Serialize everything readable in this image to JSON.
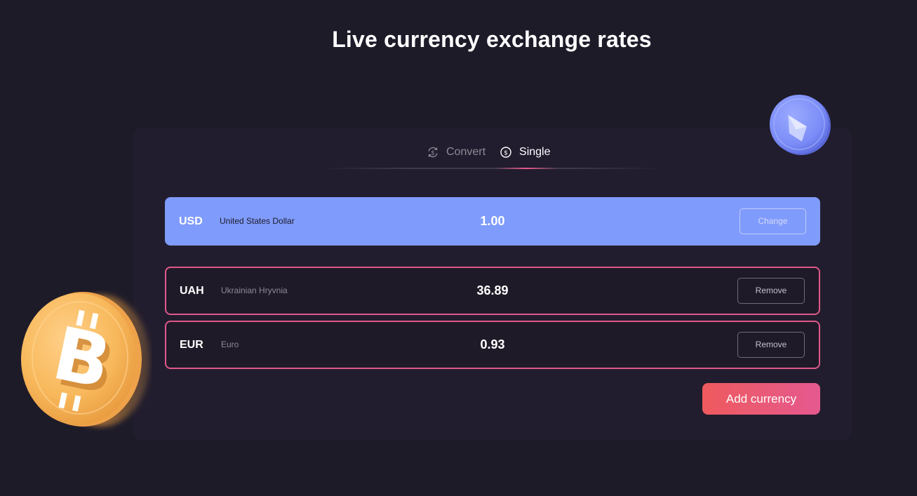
{
  "header": {
    "title": "Live currency exchange rates"
  },
  "tabs": [
    {
      "label": "Convert",
      "icon": "convert-icon",
      "active": false
    },
    {
      "label": "Single",
      "icon": "dollar-coin-icon",
      "active": true
    }
  ],
  "base": {
    "code": "USD",
    "name": "United States Dollar",
    "value": "1.00",
    "change_label": "Change"
  },
  "rates": [
    {
      "code": "UAH",
      "name": "Ukrainian Hryvnia",
      "value": "36.89",
      "remove_label": "Remove"
    },
    {
      "code": "EUR",
      "name": "Euro",
      "value": "0.93",
      "remove_label": "Remove"
    }
  ],
  "actions": {
    "add_label": "Add currency"
  },
  "decor": {
    "left_coin": "bitcoin-coin-icon",
    "right_coin": "ethereum-coin-icon"
  },
  "colors": {
    "background": "#1e1b29",
    "card": "#221d2e",
    "base_row": "#7f9bfb",
    "accent_pink": "#e0588a",
    "add_gradient_start": "#ee5a5e",
    "add_gradient_end": "#e5598f",
    "bitcoin": "#f6b55a",
    "ethereum": "#7b8cf7"
  }
}
